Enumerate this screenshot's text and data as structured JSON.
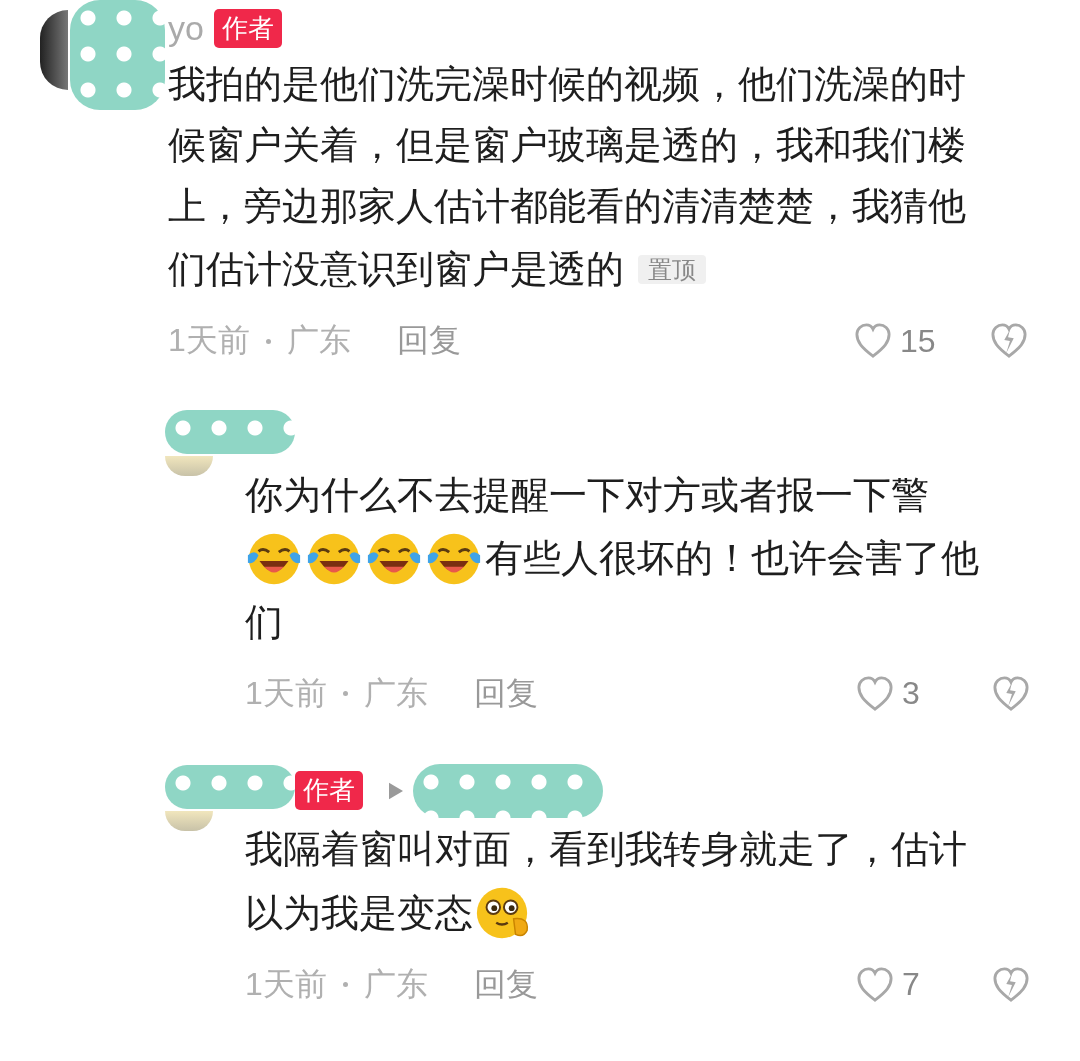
{
  "comment": {
    "name": "yo",
    "name_redacted": true,
    "badge": "作者",
    "reply_to_redacted": false,
    "segments": [
      {
        "kind": "text",
        "text": "我拍的是他们洗完澡时候的视频，他们洗澡的时候窗户关着，但是窗户玻璃是透的，我和我们楼上，旁边那家人估计都能看的清清楚楚，我猜他"
      },
      {
        "kind": "text",
        "text": "们估计没意识到窗户是透的"
      }
    ],
    "pinned_label": "置顶",
    "time": "1天前",
    "location": "广东",
    "reply": "回复",
    "likes": "15",
    "replies": [
      {
        "name_redacted": true,
        "reply_to_redacted": false,
        "segments": [
          {
            "kind": "text",
            "text": "你为什么不去提醒一下对方或者报一下警"
          },
          {
            "kind": "laughing_emoji"
          },
          {
            "kind": "laughing_emoji"
          },
          {
            "kind": "laughing_emoji"
          },
          {
            "kind": "laughing_emoji"
          },
          {
            "kind": "text",
            "text": "有些人很坏的！也许会害了他"
          },
          {
            "kind": "text",
            "text": "们"
          }
        ],
        "time": "1天前",
        "location": "广东",
        "reply": "回复",
        "likes": "3"
      },
      {
        "name_redacted": true,
        "badge": "作者",
        "reply_to_redacted": true,
        "segments": [
          {
            "kind": "text",
            "text": "我隔着窗叫对面，看到我转身就走了，估计"
          },
          {
            "kind": "text",
            "text": "以为我是变态"
          },
          {
            "kind": "shy_emoji"
          }
        ],
        "time": "1天前",
        "location": "广东",
        "reply": "回复",
        "likes": "7"
      }
    ]
  }
}
